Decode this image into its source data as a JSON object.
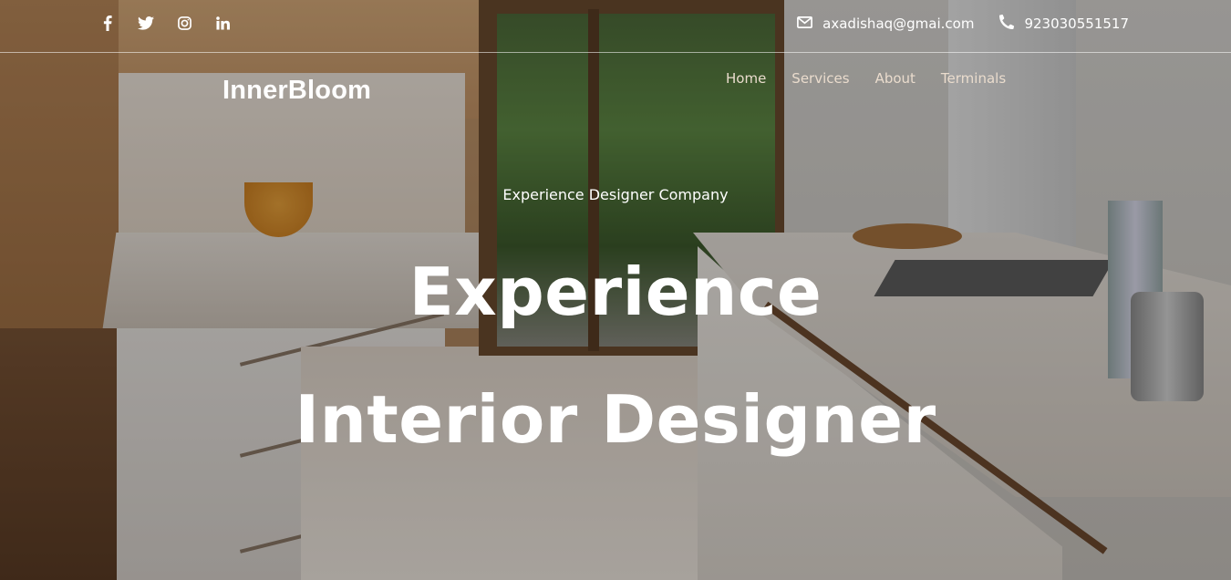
{
  "topbar": {
    "socials": [
      {
        "icon": "facebook-icon"
      },
      {
        "icon": "twitter-icon"
      },
      {
        "icon": "instagram-icon"
      },
      {
        "icon": "linkedin-icon"
      }
    ],
    "email": "axadishaq@gmai.com",
    "phone": "923030551517"
  },
  "nav": {
    "brand": "InnerBloom",
    "links": [
      "Home",
      "Services",
      "About",
      "Terminals"
    ]
  },
  "hero": {
    "tagline": "Experience Designer Company",
    "headline_line1": "Experience",
    "headline_line2": "Interior Designer"
  },
  "colors": {
    "overlay": "#000000",
    "nav_link": "#eadccd",
    "text": "#ffffff"
  }
}
